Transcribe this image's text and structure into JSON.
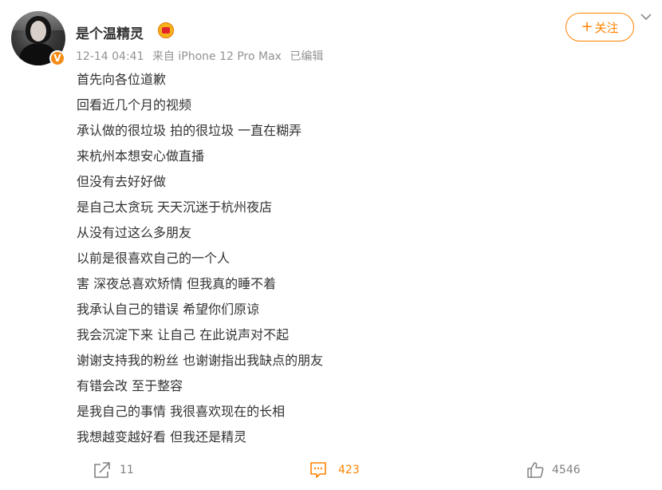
{
  "user": {
    "name": "是个温精灵",
    "verified_badge": "V"
  },
  "meta": {
    "time": "12-14 04:41",
    "source": "来自 iPhone 12 Pro Max",
    "edited": "已编辑"
  },
  "follow_button": {
    "label": "关注",
    "icon": "+"
  },
  "post": {
    "lines": [
      "首先向各位道歉",
      "回看近几个月的视频",
      "承认做的很垃圾 拍的很垃圾 一直在糊弄",
      "来杭州本想安心做直播",
      "但没有去好好做",
      "是自己太贪玩 天天沉迷于杭州夜店",
      "从没有过这么多朋友",
      "以前是很喜欢自己的一个人",
      "害 深夜总喜欢矫情 但我真的睡不着",
      "我承认自己的错误 希望你们原谅",
      "我会沉淀下来 让自己 在此说声对不起",
      "谢谢支持我的粉丝 也谢谢指出我缺点的朋友",
      "有错会改 至于整容",
      "是我自己的事情 我很喜欢现在的长相",
      "我想越变越好看 但我还是精灵"
    ]
  },
  "actions": {
    "repost": {
      "icon": "share-icon",
      "count": "11"
    },
    "comment": {
      "icon": "comment-icon",
      "count": "423"
    },
    "like": {
      "icon": "thumbs-up-icon",
      "count": "4546"
    }
  },
  "colors": {
    "accent": "#ff8200",
    "meta_text": "#939393",
    "body_text": "#333333"
  }
}
